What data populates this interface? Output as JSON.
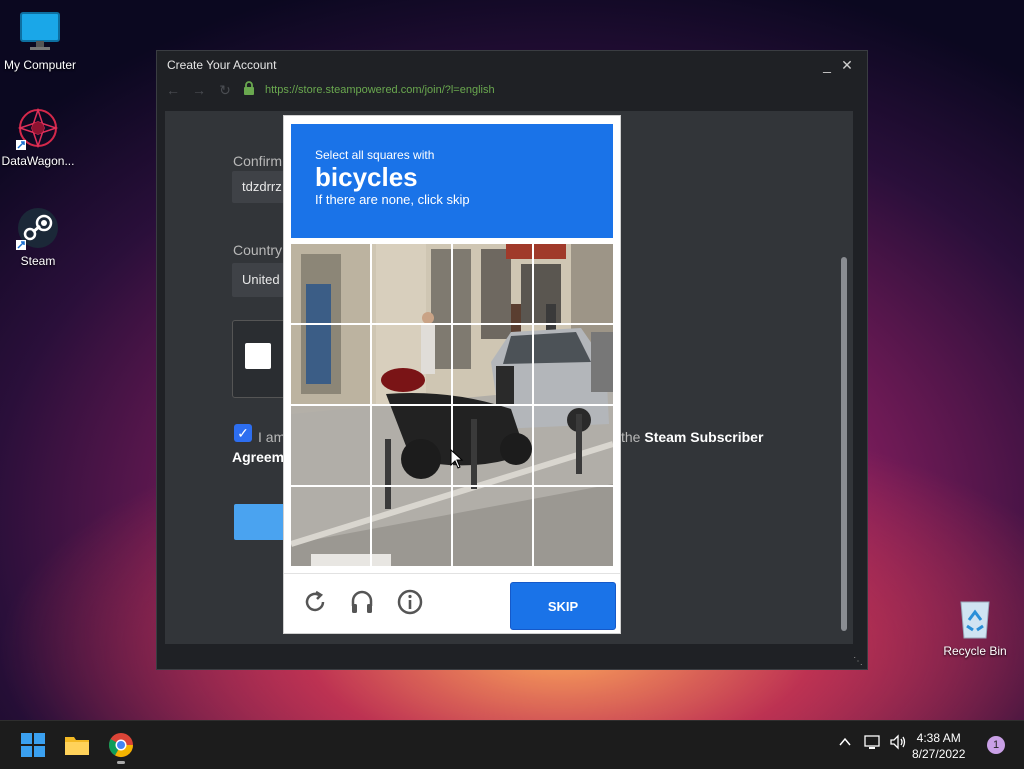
{
  "desktop": {
    "icons": [
      {
        "label": "My Computer",
        "icon": "monitor-icon"
      },
      {
        "label": "DataWagon...",
        "icon": "datawagon-icon"
      },
      {
        "label": "Steam",
        "icon": "steam-icon"
      },
      {
        "label": "Recycle Bin",
        "icon": "recycle-bin-icon"
      }
    ]
  },
  "window": {
    "title": "Create Your Account",
    "minimize": "_",
    "close": "✕",
    "url": "https://store.steampowered.com/join/?l=english"
  },
  "form": {
    "confirm_label": "Confirm",
    "confirm_value": "tdzdrrz",
    "country_label": "Country",
    "country_value": "United",
    "agree_prefix": "I am",
    "agree_suffix": "the",
    "agree_link": "Steam Subscriber",
    "agree_line2": "Agreem"
  },
  "captcha": {
    "instruction": "Select all squares with",
    "target": "bicycles",
    "hint": "If there are none, click skip",
    "skip_label": "SKIP",
    "icons": [
      "reload-icon",
      "audio-icon",
      "info-icon"
    ]
  },
  "taskbar": {
    "apps": [
      "start-icon",
      "file-explorer-icon",
      "chrome-icon"
    ],
    "time": "4:38 AM",
    "date": "8/27/2022",
    "notification_count": "1"
  }
}
